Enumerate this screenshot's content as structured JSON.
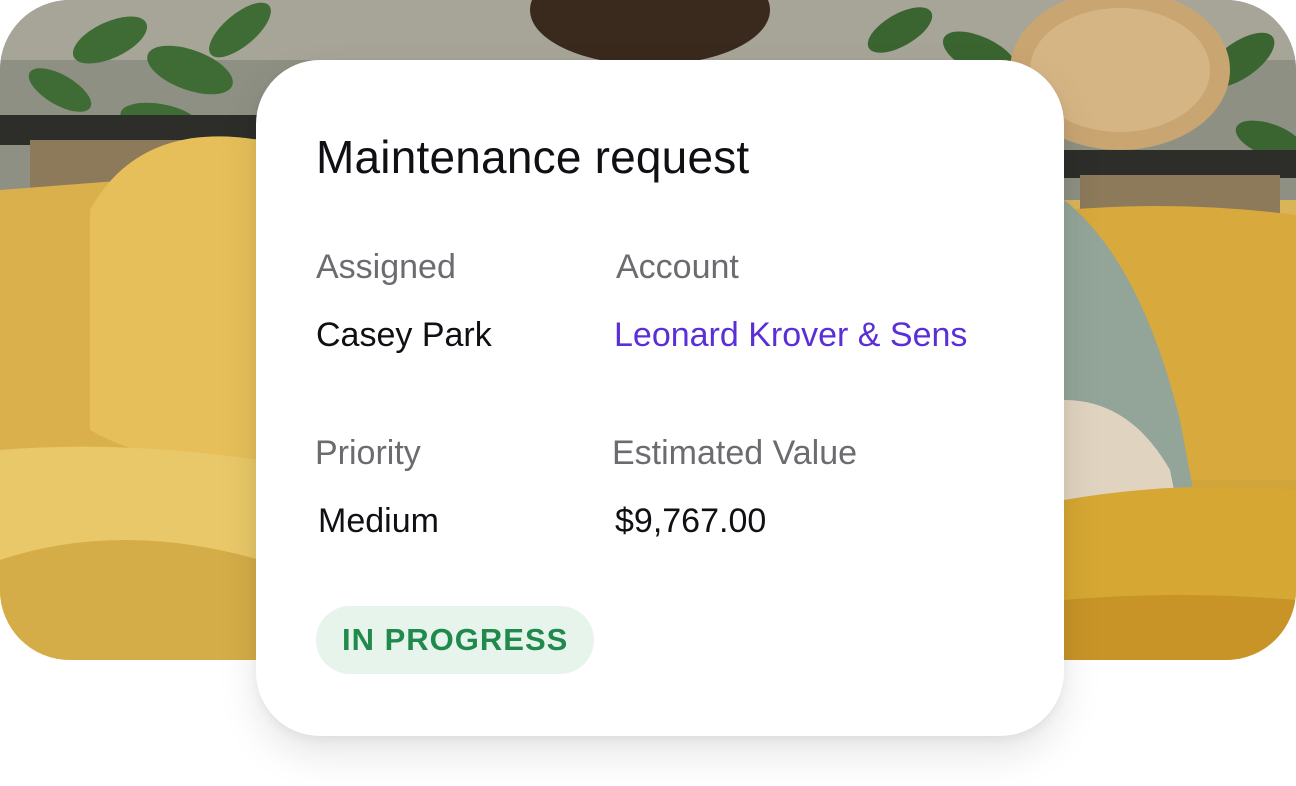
{
  "card": {
    "title": "Maintenance request",
    "fields": [
      {
        "label": "Assigned",
        "value": "Casey Park"
      },
      {
        "label": "Account",
        "value": "Leonard Krover & Sens"
      },
      {
        "label": "Priority",
        "value": "Medium"
      },
      {
        "label": "Estimated Value",
        "value": "$9,767.00"
      }
    ],
    "status": "IN PROGRESS"
  },
  "colors": {
    "link": "#5b2fd6",
    "status_bg": "#e6f4ec",
    "status_text": "#1f8a4c",
    "sofa": "#d7ac42"
  },
  "background": {
    "scene": "person-on-yellow-sofa-photo"
  }
}
